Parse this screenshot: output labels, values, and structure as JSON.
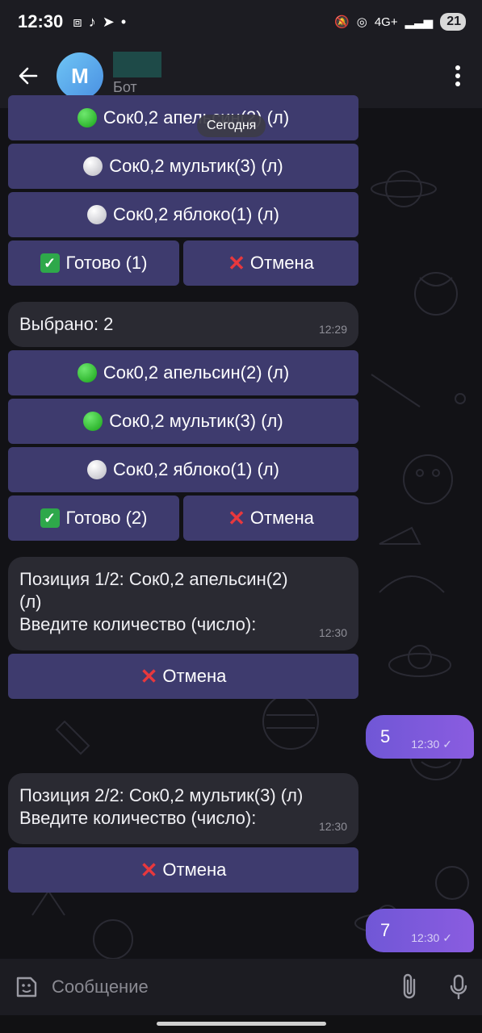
{
  "status_bar": {
    "time": "12:30",
    "network": "4G+",
    "battery": "21"
  },
  "header": {
    "avatar_letter": "M",
    "subtitle": "Бот"
  },
  "date_chip": "Сегодня",
  "keyboard1": {
    "btn_orange": "Сок0,2 апельсин(2) (л)",
    "btn_cartoon": "Сок0,2 мультик(3) (л)",
    "btn_apple": "Сок0,2 яблоко(1) (л)",
    "btn_done": "Готово (1)",
    "btn_cancel": "Отмена"
  },
  "msg_selected": {
    "text": "Выбрано: 2",
    "time": "12:29"
  },
  "keyboard2": {
    "btn_orange": "Сок0,2 апельсин(2) (л)",
    "btn_cartoon": "Сок0,2 мультик(3) (л)",
    "btn_apple": "Сок0,2 яблоко(1) (л)",
    "btn_done": "Готово (2)",
    "btn_cancel": "Отмена"
  },
  "msg_pos1": {
    "text": "Позиция 1/2: Сок0,2 апельсин(2)\n(л)\nВведите количество (число):",
    "time": "12:30",
    "cancel": "Отмена"
  },
  "out1": {
    "text": "5",
    "time": "12:30"
  },
  "msg_pos2": {
    "text": "Позиция 2/2: Сок0,2 мультик(3) (л)\nВведите количество (число):",
    "time": "12:30",
    "cancel": "Отмена"
  },
  "out2": {
    "text": "7",
    "time": "12:30"
  },
  "input": {
    "placeholder": "Сообщение"
  }
}
